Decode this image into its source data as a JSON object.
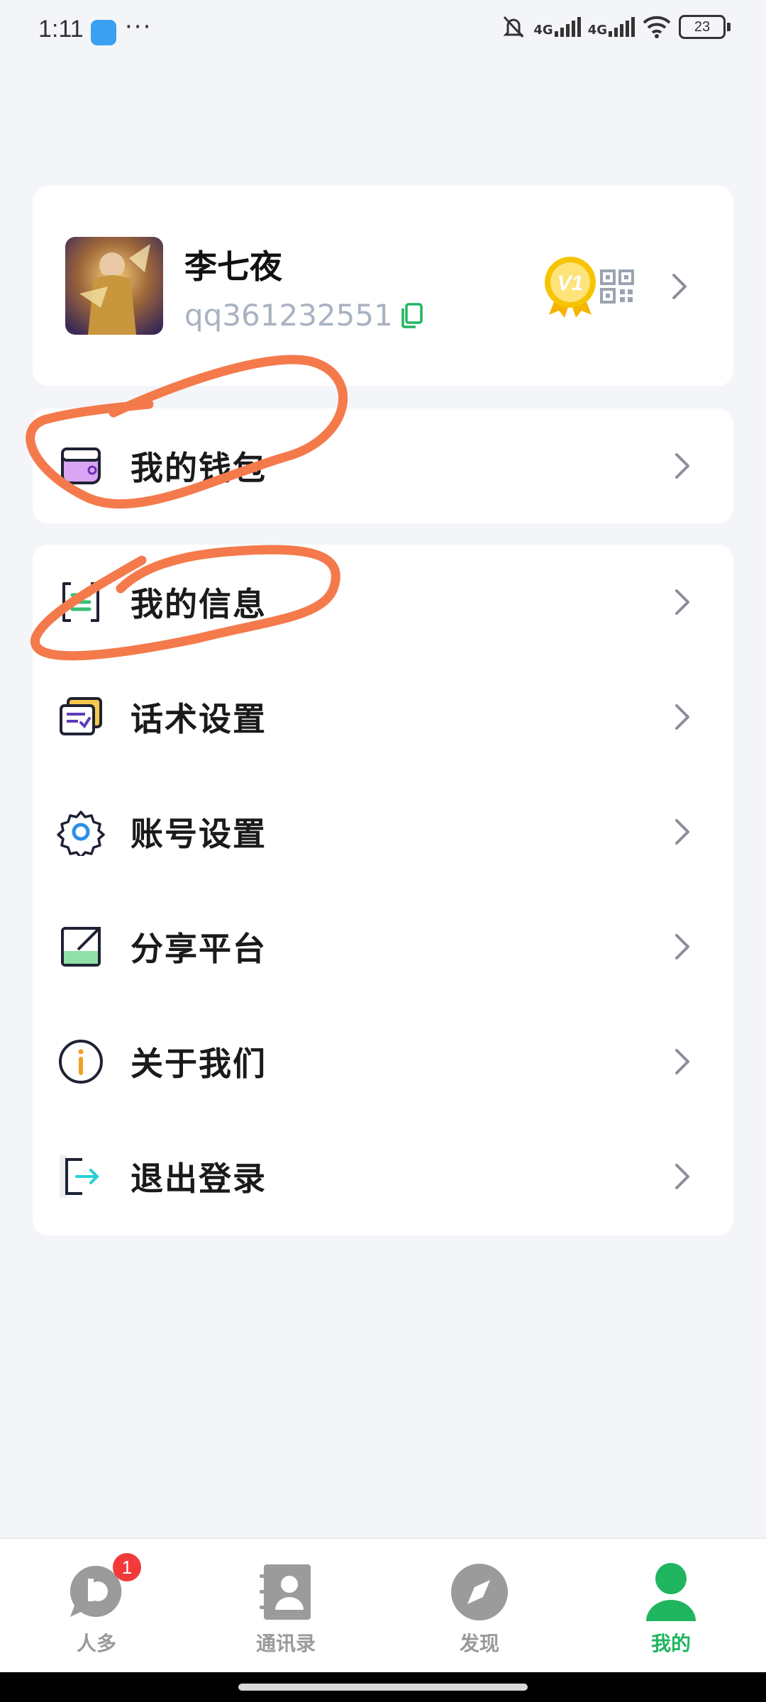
{
  "status": {
    "time": "1:11",
    "dots": "···",
    "net1": "4G",
    "net2": "4G",
    "battery": "23"
  },
  "profile": {
    "name": "李七夜",
    "id": "qq361232551",
    "vip_level": "V1"
  },
  "menu": {
    "wallet": "我的钱包",
    "info": "我的信息",
    "script": "话术设置",
    "account": "账号设置",
    "share": "分享平台",
    "about": "关于我们",
    "logout": "退出登录"
  },
  "tabs": [
    {
      "label": "人多",
      "badge": "1"
    },
    {
      "label": "通讯录"
    },
    {
      "label": "发现"
    },
    {
      "label": "我的",
      "active": true
    }
  ],
  "colors": {
    "accent": "#20b55f",
    "annotation": "#f47a4c",
    "badge": "#f23a3a"
  }
}
